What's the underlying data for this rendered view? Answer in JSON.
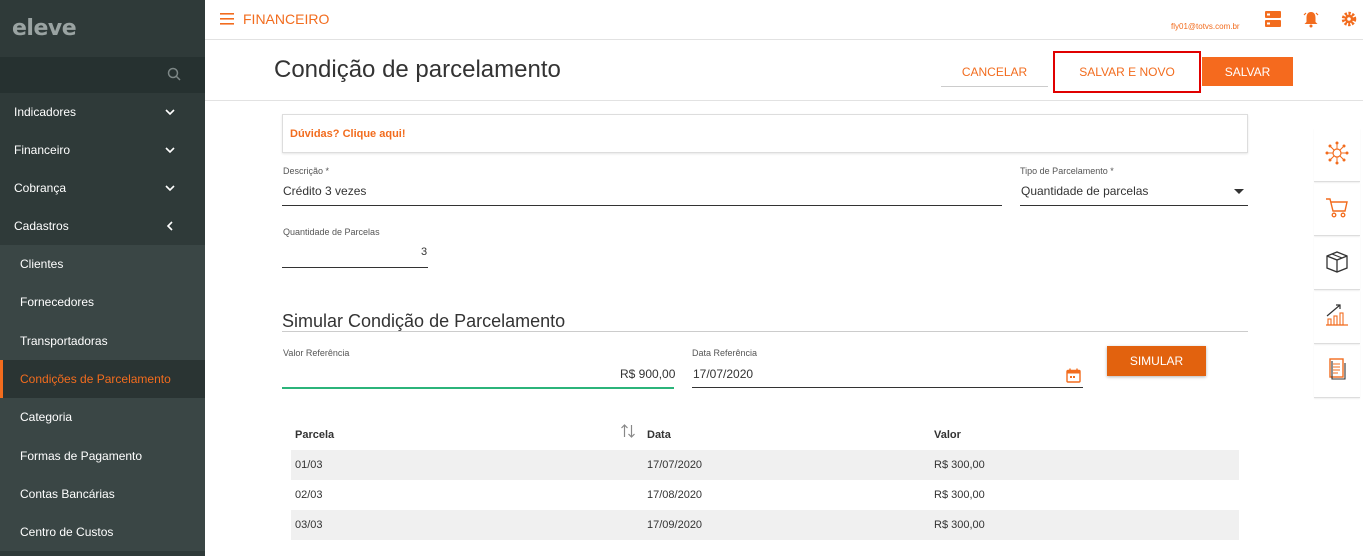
{
  "brand": {
    "logo_text": "eleve"
  },
  "sidebar": {
    "menu": [
      {
        "label": "Indicadores",
        "expanded": false
      },
      {
        "label": "Financeiro",
        "expanded": false
      },
      {
        "label": "Cobrança",
        "expanded": false
      },
      {
        "label": "Cadastros",
        "expanded": true
      }
    ],
    "submenu": [
      {
        "label": "Clientes"
      },
      {
        "label": "Fornecedores"
      },
      {
        "label": "Transportadoras"
      },
      {
        "label": "Condições de Parcelamento",
        "active": true
      },
      {
        "label": "Categoria"
      },
      {
        "label": "Formas de Pagamento"
      },
      {
        "label": "Contas Bancárias"
      },
      {
        "label": "Centro de Custos"
      }
    ]
  },
  "topbar": {
    "module": "FINANCEIRO",
    "user_email": "fly01@totvs.com.br"
  },
  "header": {
    "title": "Condição de parcelamento",
    "cancel_label": "CANCELAR",
    "save_new_label": "SALVAR E NOVO",
    "save_label": "SALVAR"
  },
  "help": {
    "text": "Dúvidas? Clique aqui!"
  },
  "form": {
    "descricao_label": "Descrição *",
    "descricao_value": "Crédito 3 vezes",
    "tipo_label": "Tipo de Parcelamento *",
    "tipo_value": "Quantidade de parcelas",
    "qtd_label": "Quantidade de Parcelas",
    "qtd_value": "3"
  },
  "simulation": {
    "title": "Simular Condição de Parcelamento",
    "valor_label": "Valor Referência",
    "valor_value": "R$ 900,00",
    "data_label": "Data Referência",
    "data_value": "17/07/2020",
    "button_label": "SIMULAR"
  },
  "table": {
    "headers": {
      "parcela": "Parcela",
      "data": "Data",
      "valor": "Valor"
    },
    "rows": [
      {
        "parcela": "01/03",
        "data": "17/07/2020",
        "valor": "R$ 300,00"
      },
      {
        "parcela": "02/03",
        "data": "17/08/2020",
        "valor": "R$ 300,00"
      },
      {
        "parcela": "03/03",
        "data": "17/09/2020",
        "valor": "R$ 300,00"
      }
    ]
  },
  "colors": {
    "accent": "#f26c1e",
    "sidebar_bg": "#2f3a39",
    "highlight_border": "#e00000"
  }
}
